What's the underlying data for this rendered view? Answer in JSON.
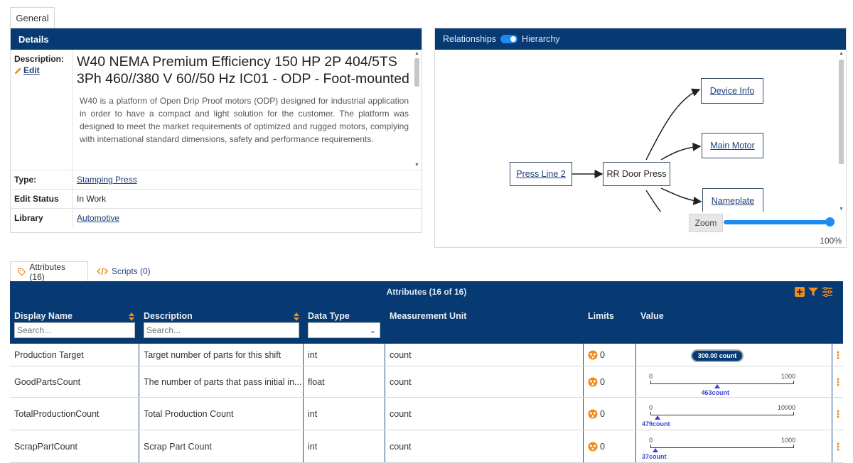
{
  "top_tab": "General",
  "details": {
    "header": "Details",
    "description_label": "Description:",
    "edit_label": "Edit",
    "title": "W40 NEMA Premium Efficiency 150 HP 2P 404/5TS 3Ph 460//380 V 60//50 Hz IC01 - ODP - Foot-mounted",
    "text": "W40 is a platform of Open Drip Proof motors (ODP) designed for industrial application in order to have a compact and light solution for the customer. The platform was designed to meet the market requirements of optimized and rugged motors, complying with international standard dimensions, safety and performance requirements.",
    "rows": [
      {
        "label": "Type:",
        "value": "Stamping Press",
        "link": true
      },
      {
        "label": "Edit Status",
        "value": "In Work",
        "link": false
      },
      {
        "label": "Library",
        "value": "Automotive",
        "link": true
      }
    ]
  },
  "relationships": {
    "label_left": "Relationships",
    "label_right": "Hierarchy",
    "toggle_on": true,
    "nodes": {
      "press_line": "Press Line 2",
      "rr_door": "RR Door Press",
      "device_info": "Device Info",
      "main_motor": "Main Motor",
      "nameplate": "Nameplate"
    },
    "zoom_label": "Zoom",
    "zoom_pct": "100%"
  },
  "bottom_tabs": {
    "attributes": "Attributes (16)",
    "scripts": "Scripts (0)"
  },
  "attributes": {
    "title": "Attributes (16 of 16)",
    "columns": {
      "display_name": "Display Name",
      "description": "Description",
      "data_type": "Data Type",
      "unit": "Measurement Unit",
      "limits": "Limits",
      "value": "Value"
    },
    "search_placeholder": "Search...",
    "rows": [
      {
        "name": "Production Target",
        "description": "Target number of parts for this shift",
        "type": "int",
        "unit": "count",
        "limits": "0",
        "badge": "300.00 count"
      },
      {
        "name": "GoodPartsCount",
        "description": "The number of parts that pass initial in...",
        "type": "float",
        "unit": "count",
        "limits": "0",
        "min": "0",
        "max": "1000",
        "value": "463count",
        "fraction": 0.463
      },
      {
        "name": "TotalProductionCount",
        "description": "Total Production Count",
        "type": "int",
        "unit": "count",
        "limits": "0",
        "min": "0",
        "max": "10000",
        "value": "479count",
        "fraction": 0.0479
      },
      {
        "name": "ScrapPartCount",
        "description": "Scrap Part Count",
        "type": "int",
        "unit": "count",
        "limits": "0",
        "min": "0",
        "max": "1000",
        "value": "37count",
        "fraction": 0.037
      }
    ]
  },
  "colors": {
    "header_navy": "#073a73",
    "accent_orange": "#f08c1d",
    "toggle_blue": "#1d8cf0",
    "marker_blue": "#3a45d6"
  }
}
